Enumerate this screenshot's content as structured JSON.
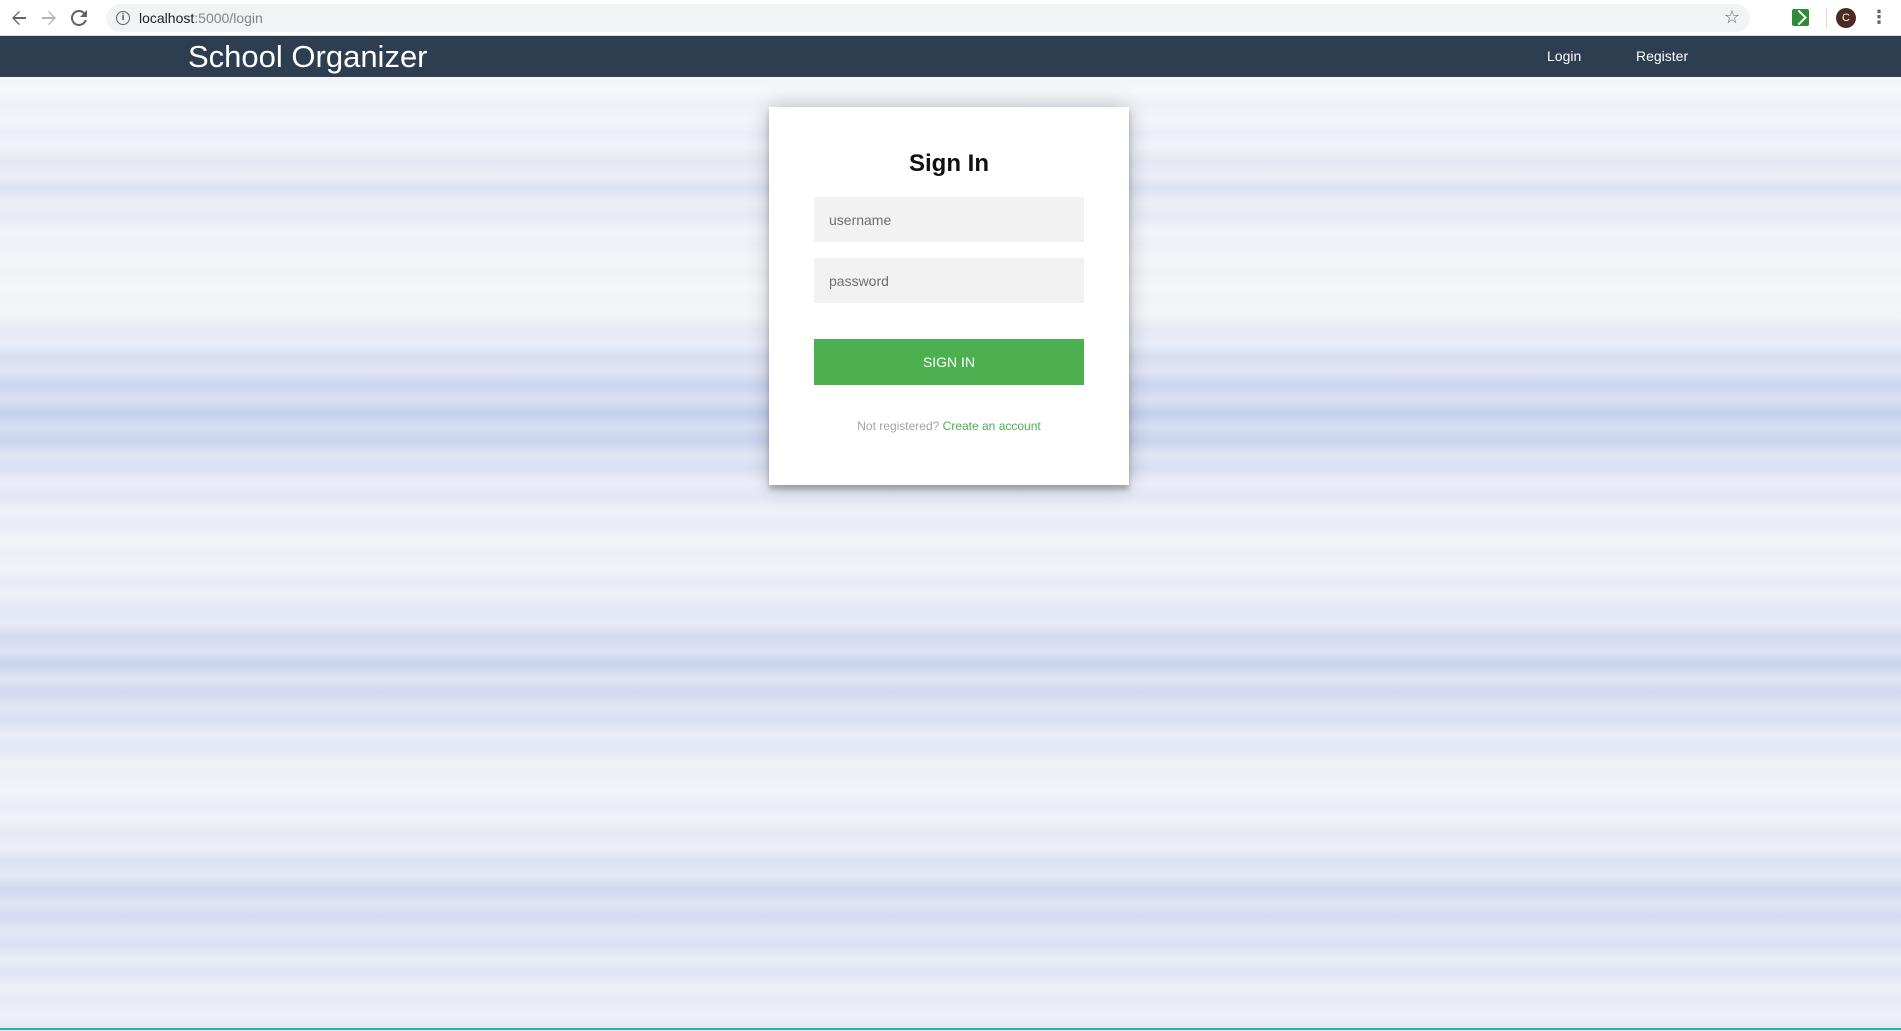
{
  "browser": {
    "url_host": "localhost",
    "url_path": ":5000/login",
    "profile_initial": "C",
    "icons": {
      "back": "arrow-left-icon",
      "forward": "arrow-right-icon",
      "reload": "reload-icon",
      "info": "info-icon",
      "bookmark": "star-icon",
      "extension": "extension-icon",
      "menu": "kebab-menu-icon"
    }
  },
  "header": {
    "title": "School Organizer",
    "nav": {
      "login": "Login",
      "register": "Register"
    },
    "background_color": "#2c3e50"
  },
  "login_form": {
    "title": "Sign In",
    "username_placeholder": "username",
    "password_placeholder": "password",
    "submit_label": "SIGN IN",
    "register_prompt": "Not registered?",
    "register_link": "Create an account",
    "accent_color": "#4caf50"
  }
}
